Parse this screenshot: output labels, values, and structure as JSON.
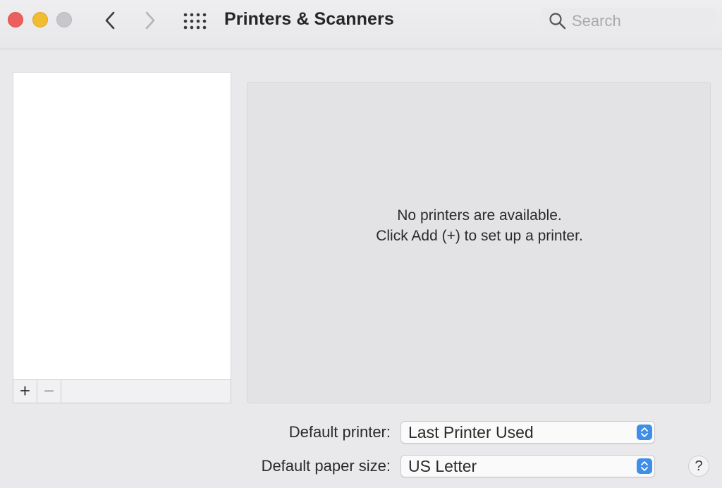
{
  "window": {
    "title": "Printers & Scanners",
    "traffic_lights": {
      "close": "#ec5f5c",
      "minimize": "#f1bc2f",
      "zoom": "#c7c6ca"
    }
  },
  "toolbar": {
    "back_icon": "chevron-left-icon",
    "forward_icon": "chevron-right-icon",
    "show_all_icon": "grid-icon"
  },
  "search": {
    "placeholder": "Search",
    "value": ""
  },
  "printer_list": {
    "items": [],
    "add_label": "+",
    "remove_label": "−"
  },
  "detail": {
    "empty_line1": "No printers are available.",
    "empty_line2": "Click Add (+) to set up a printer."
  },
  "settings": {
    "default_printer_label": "Default printer:",
    "default_printer_value": "Last Printer Used",
    "default_paper_label": "Default paper size:",
    "default_paper_value": "US Letter"
  },
  "help": {
    "label": "?"
  },
  "colors": {
    "accent": "#3f8ee9"
  }
}
